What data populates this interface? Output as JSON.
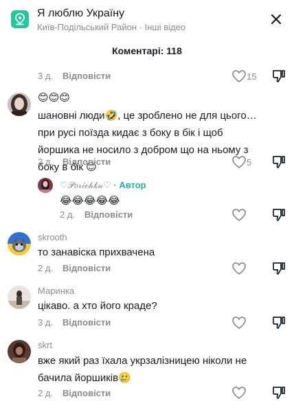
{
  "header": {
    "title": "Я люблю Україну",
    "subtitle": "Київ-Подільський Район · Інші відео"
  },
  "comments_title": "Коментарі: 118",
  "top_row": {
    "time": "3 д.",
    "reply": "Відповісти",
    "likes": "15"
  },
  "comments": [
    {
      "username": "",
      "emoji_line": "😊😊😊",
      "text": "шановні люди🤣, це зроблено не для цього… при русі поїзда кидає з боку в бік і щоб йоршика не носило з добром що на ньому з боку в бік 😊",
      "time": "2 д.",
      "reply": "Відповісти",
      "likes": "5"
    },
    {
      "username": "♡𝒫𝑜𝓇𝒾𝒸𝒽𝓀𝒶♡",
      "badge": "· Автор",
      "text": "😂😂😂😂😂",
      "time": "2 д.",
      "reply": "Відповісти",
      "likes": ""
    },
    {
      "username": "skrooth",
      "text": "то занавіска прихвачена",
      "time": "2 д.",
      "reply": "Відповісти",
      "likes": ""
    },
    {
      "username": "Маринка",
      "text": "цікаво. а хто його краде?",
      "time": "3 д.",
      "reply": "Відповісти",
      "likes": ""
    },
    {
      "username": "skrt",
      "text": "вже який раз їхала укрзалізницею ніколи не бачила йоршиків🥲",
      "time": "2 д.",
      "reply": "Відповісти",
      "likes": ""
    }
  ],
  "colors": {
    "accent": "#20b3a0",
    "location_icon": "#20c997",
    "secondary_text": "#8a8b91"
  }
}
